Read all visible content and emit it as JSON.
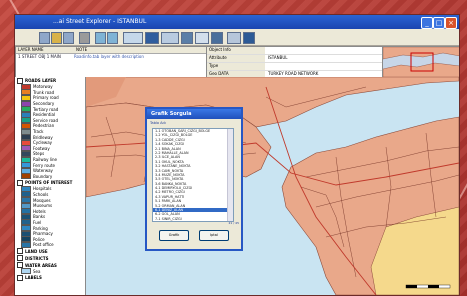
{
  "window": {
    "title": "...ai Street Explorer - ISTANBUL",
    "controls": [
      "_",
      "□",
      "×"
    ]
  },
  "toolbar": {
    "icons": [
      "new-icon",
      "open-icon",
      "save-icon",
      "print-icon",
      "zoom-in-icon",
      "zoom-out-icon",
      "pan-icon",
      "select-icon",
      "measure-icon",
      "layers-icon",
      "query-icon",
      "legend-icon",
      "grid-icon",
      "info-icon"
    ]
  },
  "info_table": {
    "columns": [
      "LAYER NAME",
      "NOTE"
    ],
    "rows": [
      [
        "1 STREET OBJ 1 MAIN",
        "Roadinfo.tab layer with description"
      ]
    ]
  },
  "properties": {
    "rows": [
      {
        "key": "Object Info",
        "value": ""
      },
      {
        "key": "Attribute",
        "value": "ISTANBUL"
      },
      {
        "key": "Type",
        "value": ""
      },
      {
        "key": "Geo DATA",
        "value": "TURKEY ROAD NETWORK"
      }
    ]
  },
  "legend": {
    "groups": [
      {
        "label": "ROADS LAYER",
        "items": [
          {
            "label": "Motorway",
            "color": "#c0392b"
          },
          {
            "label": "Trunk road",
            "color": "#e67e22"
          },
          {
            "label": "Primary road",
            "color": "#f1c40f"
          },
          {
            "label": "Secondary",
            "color": "#8e44ad"
          },
          {
            "label": "Tertiary road",
            "color": "#27ae60"
          },
          {
            "label": "Residential",
            "color": "#2980b9"
          },
          {
            "label": "Service road",
            "color": "#16a085"
          },
          {
            "label": "Pedestrian",
            "color": "#d35400"
          },
          {
            "label": "Track",
            "color": "#7f8c8d"
          },
          {
            "label": "Bridleway",
            "color": "#2c3e50"
          },
          {
            "label": "Cycleway",
            "color": "#e74c3c"
          },
          {
            "label": "Footway",
            "color": "#9b59b6"
          },
          {
            "label": "Steps",
            "color": "#34495e"
          },
          {
            "label": "Railway line",
            "color": "#1abc9c"
          },
          {
            "label": "Ferry route",
            "color": "#3498db"
          },
          {
            "label": "Waterway",
            "color": "#5dade2"
          },
          {
            "label": "Boundary",
            "color": "#a04000"
          }
        ]
      },
      {
        "label": "POINTS OF INTEREST",
        "items": [
          {
            "label": "Hospitals",
            "color": "#2e86c1"
          },
          {
            "label": "Schools",
            "color": "#1f618d"
          },
          {
            "label": "Mosques",
            "color": "#2874a6"
          },
          {
            "label": "Museums",
            "color": "#5499c7"
          },
          {
            "label": "Hotels",
            "color": "#2471a3"
          },
          {
            "label": "Banks",
            "color": "#1a5276"
          },
          {
            "label": "Fuel",
            "color": "#21618c"
          },
          {
            "label": "Parking",
            "color": "#2e86c1"
          },
          {
            "label": "Pharmacy",
            "color": "#1b4f72"
          },
          {
            "label": "Police",
            "color": "#154360"
          },
          {
            "label": "Post office",
            "color": "#2874a6"
          }
        ]
      },
      {
        "label": "LAND USE",
        "items": []
      },
      {
        "label": "DISTRICTS",
        "items": []
      },
      {
        "label": "WATER AREAS",
        "items": [
          {
            "label": "Sea",
            "color": "#aed6f1"
          }
        ]
      },
      {
        "label": "LABELS",
        "items": []
      }
    ]
  },
  "dialog": {
    "title": "Grafik Sorgula",
    "list_label": "Tablo Adı",
    "items": [
      "1-1 OTOBAN_SARI_CIZGI_BOLGE",
      "1-2 YOL_CIZGI_BOLGE",
      "1-3 CADDE_CIZGI",
      "1-4 SOKAK_CIZGI",
      "2-1 BINA_ALAN",
      "2-2 MAHALLE_ALAN",
      "2-3 ILCE_ALAN",
      "3-1 OKUL_NOKTA",
      "3-2 HASTANE_NOKTA",
      "3-3 CAMI_NOKTA",
      "3-4 MUZE_NOKTA",
      "3-5 OTEL_NOKTA",
      "3-6 BANKA_NOKTA",
      "4-1 DEMIRYOLU_CIZGI",
      "4-2 METRO_CIZGI",
      "4-3 VAPUR_HATTI",
      "5-1 PARK_ALAN",
      "5-2 ORMAN_ALAN",
      "6-1 DENIZ_ALAN",
      "6-2 GOL_ALAN",
      "7-1 SINIR_CIZGI"
    ],
    "selected_index": 18,
    "buttons": [
      "Grafik",
      "Iptal"
    ],
    "count_text": "21 / 45"
  },
  "colors": {
    "land": "#e9a88a",
    "land_stroke": "#8b4a3a",
    "sea": "#c9e4f2",
    "yellow_land": "#f5d98c",
    "road_red": "#c0392b",
    "frame": "#b43a36",
    "selection": "#316ac5"
  }
}
